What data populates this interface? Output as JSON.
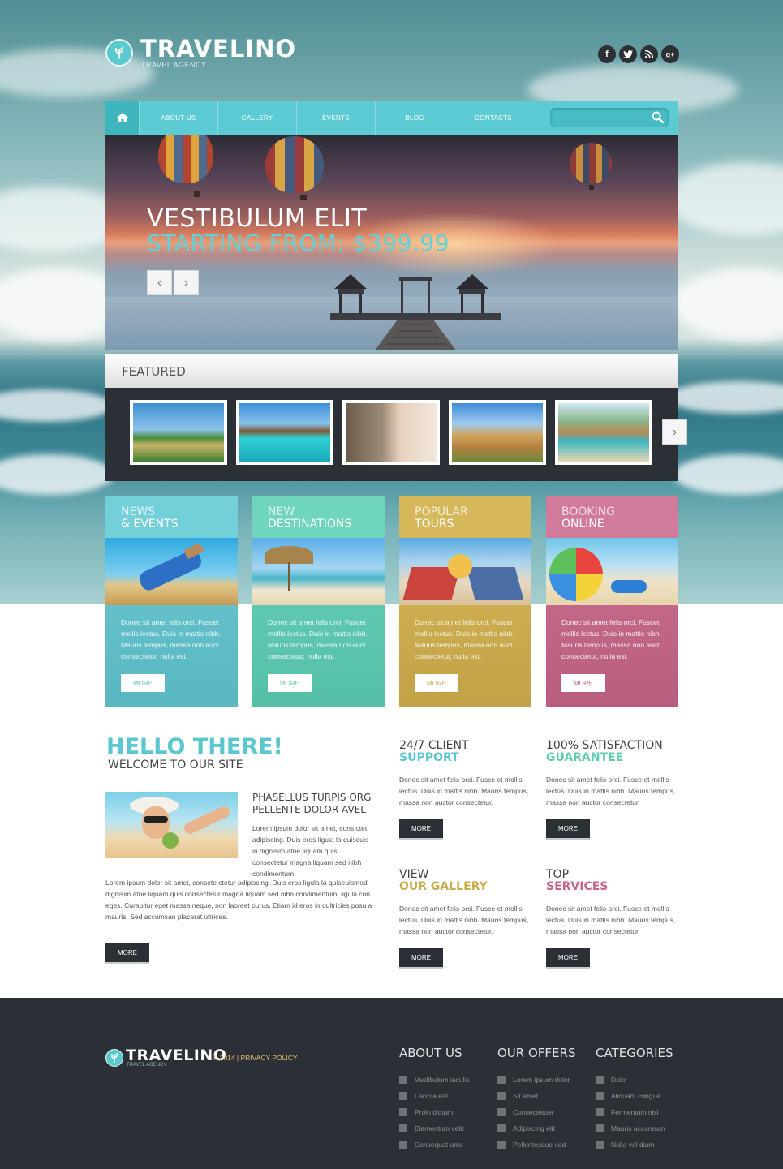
{
  "header": {
    "brand": "TRAVELINO",
    "tagline": "TRAVEL AGENCY",
    "social": [
      "f",
      "t",
      "rss",
      "g+"
    ]
  },
  "nav": {
    "items": [
      "ABOUT US",
      "GALLERY",
      "EVENTS",
      "BLOG",
      "CONTACTS"
    ],
    "search_placeholder": ""
  },
  "hero": {
    "title": "VESTIBULUM ELIT",
    "price": "STARTING FROM: $399.99",
    "prev": "‹",
    "next": "›"
  },
  "featured": {
    "heading": "FEATURED",
    "next": "›"
  },
  "boxes": [
    {
      "line1": "NEWS",
      "line2": "& EVENTS",
      "text": "Donec sit amet felis orci. Fuscet mollis lectus. Duis in mattis nibh. Mauris tempus, massa non auct consectetur, nulla est.",
      "more": "MORE",
      "color": "#5fc4cd"
    },
    {
      "line1": "NEW",
      "line2": "DESTINATIONS",
      "text": "Donec sit amet felis orci. Fuscet mollis lectus. Duis in mattis nibh. Mauris tempus, massa non auct consectetur, nulla est.",
      "more": "MORE",
      "color": "#5fcbb1"
    },
    {
      "line1": "POPULAR",
      "line2": "TOURS",
      "text": "Donec sit amet felis orci. Fuscet mollis lectus. Duis in mattis nibh. Mauris tempus, massa non auct consectetur, nulla est.",
      "more": "MORE",
      "color": "#cbad4f"
    },
    {
      "line1": "BOOKING",
      "line2": "ONLINE",
      "text": "Donec sit amet felis orci. Fuscet mollis lectus. Duis in mattis nibh. Mauris tempus, massa non auct consectetur, nulla est.",
      "more": "MORE",
      "color": "#c7658a"
    }
  ],
  "hello": {
    "title": "HELLO THERE!",
    "subtitle": "WELCOME TO OUR SITE",
    "heading_line1": "PHASELLUS TURPIS ORG",
    "heading_line2": "PELLENTE DOLOR AVEL",
    "para1": "Lorem ipsum dolor sit amet, cons ctet adipiscing. Duis eros ligula la quiseuis in dignisim atne liquam quis consectetur magna liquam sed nibh condimentum.",
    "para2": "Lorem ipsum dolor sit amet, consete ctetur adipiscing. Duis eros ligula la quiseuismod dignisim atne liquam quis consectetur magna liquam sed nibh condimentum. ligula con eges. Curabitur eget massa neque, non laoreet purus. Etiam id eros in dultricies posu a mauris. Sed accumsan placerat ultrices.",
    "more": "MORE"
  },
  "features": [
    {
      "a": "24/7 CLIENT",
      "b": "SUPPORT",
      "color": "#5bc8cf",
      "text": "Donec sit amet felis orci. Fusce et mollis lectus. Duis in mattis nibh. Mauris tempus, massa non auctor consectetur.",
      "more": "MORE"
    },
    {
      "a": "100% SATISFACTION",
      "b": "GUARANTEE",
      "color": "#5fcbb1",
      "text": "Donec sit amet felis orci. Fusce et mollis lectus. Duis in mattis nibh. Mauris tempus, massa non auctor consectetur.",
      "more": "MORE"
    },
    {
      "a": "VIEW",
      "b": "OUR GALLERY",
      "color": "#cbad4f",
      "text": "Donec sit amet felis orci. Fusce et mollis lectus. Duis in mattis nibh. Mauris tempus, massa non auctor consectetur.",
      "more": "MORE"
    },
    {
      "a": "TOP",
      "b": "SERVICES",
      "color": "#c7658a",
      "text": "Donec sit amet felis orci. Fusce et mollis lectus. Duis in mattis nibh. Mauris tempus, massa non auctor consectetur.",
      "more": "MORE"
    }
  ],
  "footer": {
    "brand": "TRAVELINO",
    "tagline": "TRAVEL AGENCY",
    "copyright": "© 2014  |  PRIVACY POLICY",
    "columns": [
      {
        "title": "ABOUT US",
        "items": [
          "Vestibulum iaculis",
          "Lacinia est",
          "Proin dictum",
          "Elementum velit",
          "Consequat ante"
        ]
      },
      {
        "title": "OUR OFFERS",
        "items": [
          "Lorem ipsum dolor",
          "Sit amet",
          "Consectetuer",
          "Adipiscing elit",
          "Pellentesque sed"
        ]
      },
      {
        "title": "CATEGORIES",
        "items": [
          "Dolor",
          "Aliquam congue",
          "Fermentum nisl",
          "Mauris accumsan",
          "Nulla vel diam"
        ]
      }
    ]
  },
  "colors": {
    "accent": "#5ccbd3",
    "dark": "#2b3036",
    "teal": "#5fc4cd",
    "mint": "#5fcbb1",
    "gold": "#cbad4f",
    "pink": "#c7658a"
  }
}
